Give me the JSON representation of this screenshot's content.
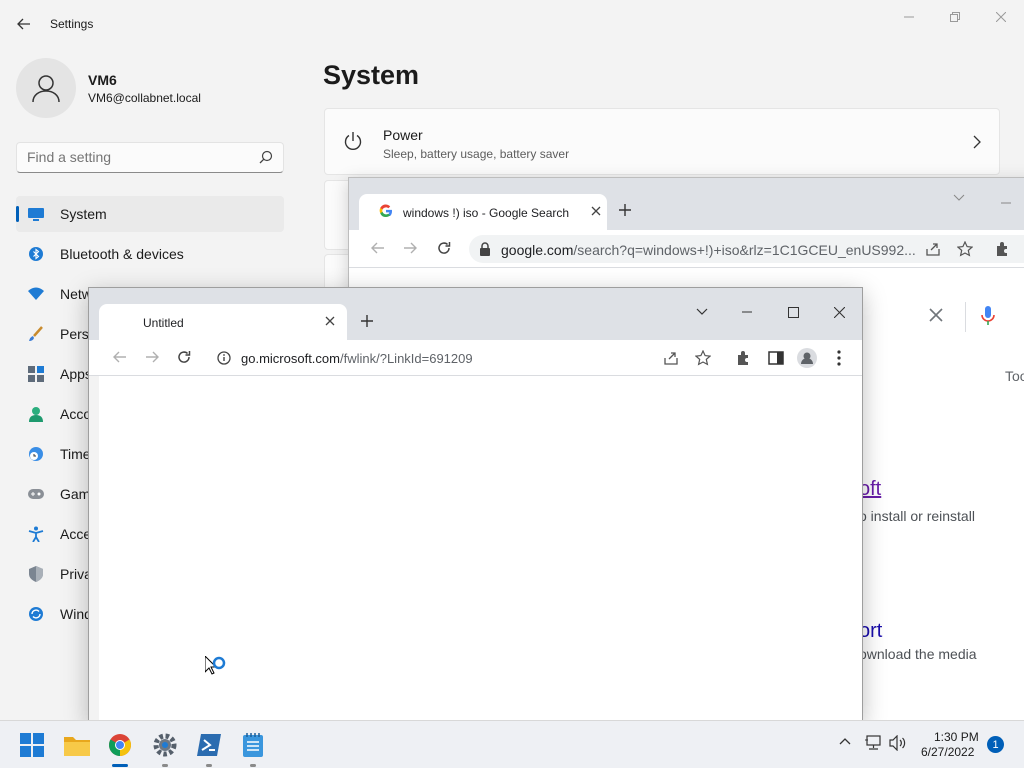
{
  "settings": {
    "window_title": "Settings",
    "user": {
      "name": "VM6",
      "email": "VM6@collabnet.local"
    },
    "search_placeholder": "Find a setting",
    "nav": [
      {
        "label": "System",
        "icon": "monitor-icon",
        "active": true
      },
      {
        "label": "Bluetooth & devices",
        "icon": "bluetooth-icon"
      },
      {
        "label": "Netw",
        "icon": "wifi-icon"
      },
      {
        "label": "Pers",
        "icon": "brush-icon"
      },
      {
        "label": "Apps",
        "icon": "apps-icon"
      },
      {
        "label": "Acco",
        "icon": "person-icon"
      },
      {
        "label": "Time",
        "icon": "clock-globe-icon"
      },
      {
        "label": "Gam",
        "icon": "gamepad-icon"
      },
      {
        "label": "Acce",
        "icon": "accessibility-icon"
      },
      {
        "label": "Priva",
        "icon": "shield-icon"
      },
      {
        "label": "Wind",
        "icon": "windows-update-icon"
      }
    ],
    "page_title": "System",
    "power_card": {
      "title": "Power",
      "subtitle": "Sleep, battery usage, battery saver"
    }
  },
  "chrome_back": {
    "tab_title": "windows !) iso - Google Search",
    "url_host": "google.com",
    "url_rest": "/search?q=windows+!)+iso&rlz=1C1GCEU_enUS992...",
    "tools_label": "Too",
    "result1_link": "oft",
    "result1_snippet": "o install or reinstall",
    "result2_link": "ort",
    "result2_snippet": "ownload the media"
  },
  "chrome_front": {
    "tab_title": "Untitled",
    "url_host": "go.microsoft.com",
    "url_rest": "/fwlink/?LinkId=691209"
  },
  "taskbar": {
    "apps": [
      "windows-start-icon",
      "file-explorer-icon",
      "chrome-icon",
      "settings-icon",
      "powershell-icon",
      "notepad-icon"
    ],
    "time": "1:30 PM",
    "date": "6/27/2022",
    "notification_count": "1"
  },
  "colors": {
    "accent": "#005fb8",
    "visited_link": "#681da8",
    "link": "#1a0dab"
  }
}
